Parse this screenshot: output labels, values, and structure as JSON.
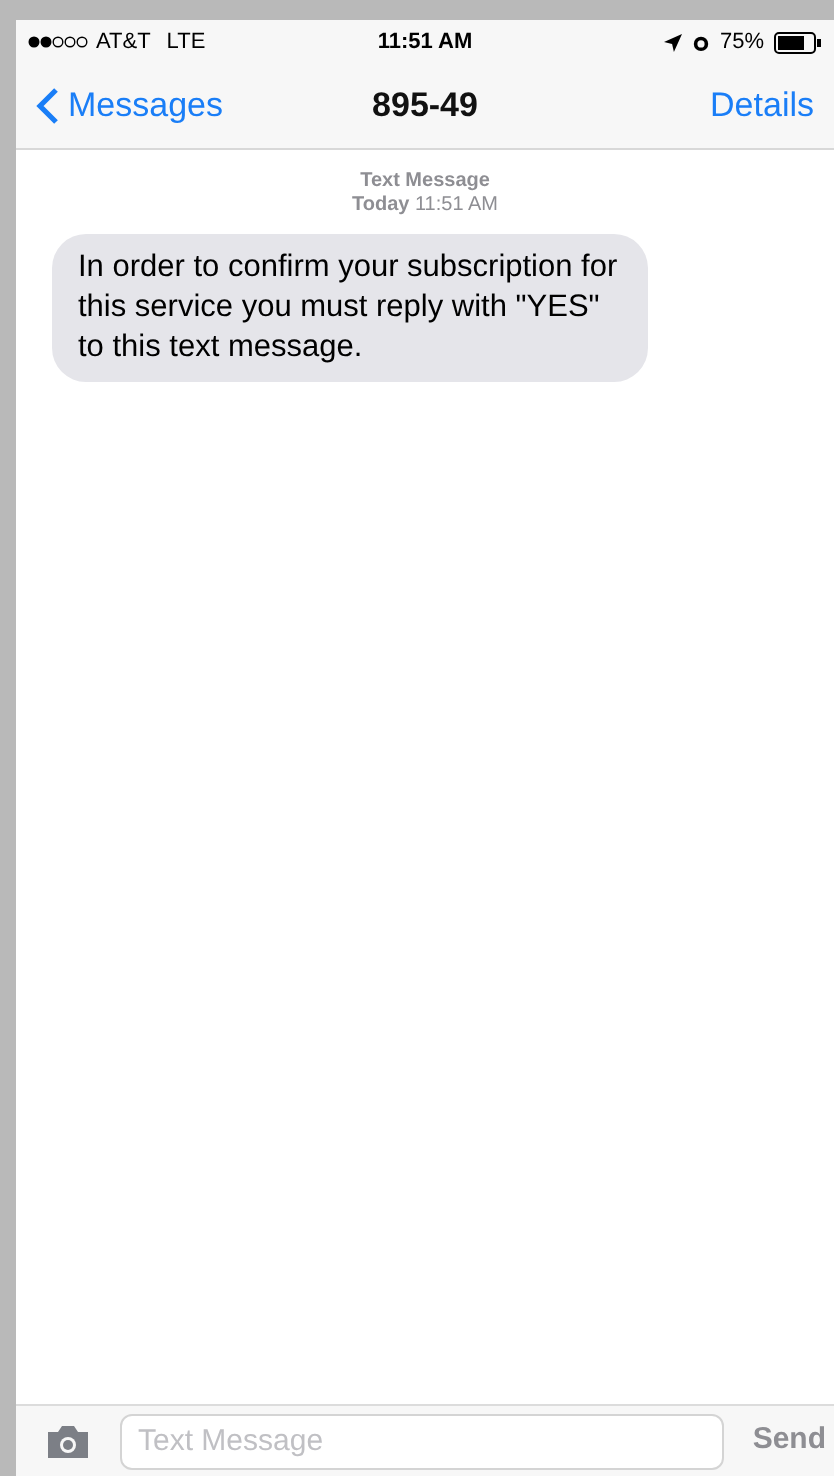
{
  "status_bar": {
    "carrier": "AT&T",
    "network": "LTE",
    "time": "11:51 AM",
    "battery": "75%"
  },
  "nav": {
    "back": "Messages",
    "title": "895-49",
    "action": "Details"
  },
  "thread": {
    "header": "Text Message",
    "timestamp": "**Today** 11:51 AM",
    "messages": [
      {
        "text": "In order to confirm your subscription for this service you must reply with \"YES\" to this text message."
      }
    ]
  },
  "composer": {
    "placeholder": "Text Message",
    "send": "Send"
  }
}
